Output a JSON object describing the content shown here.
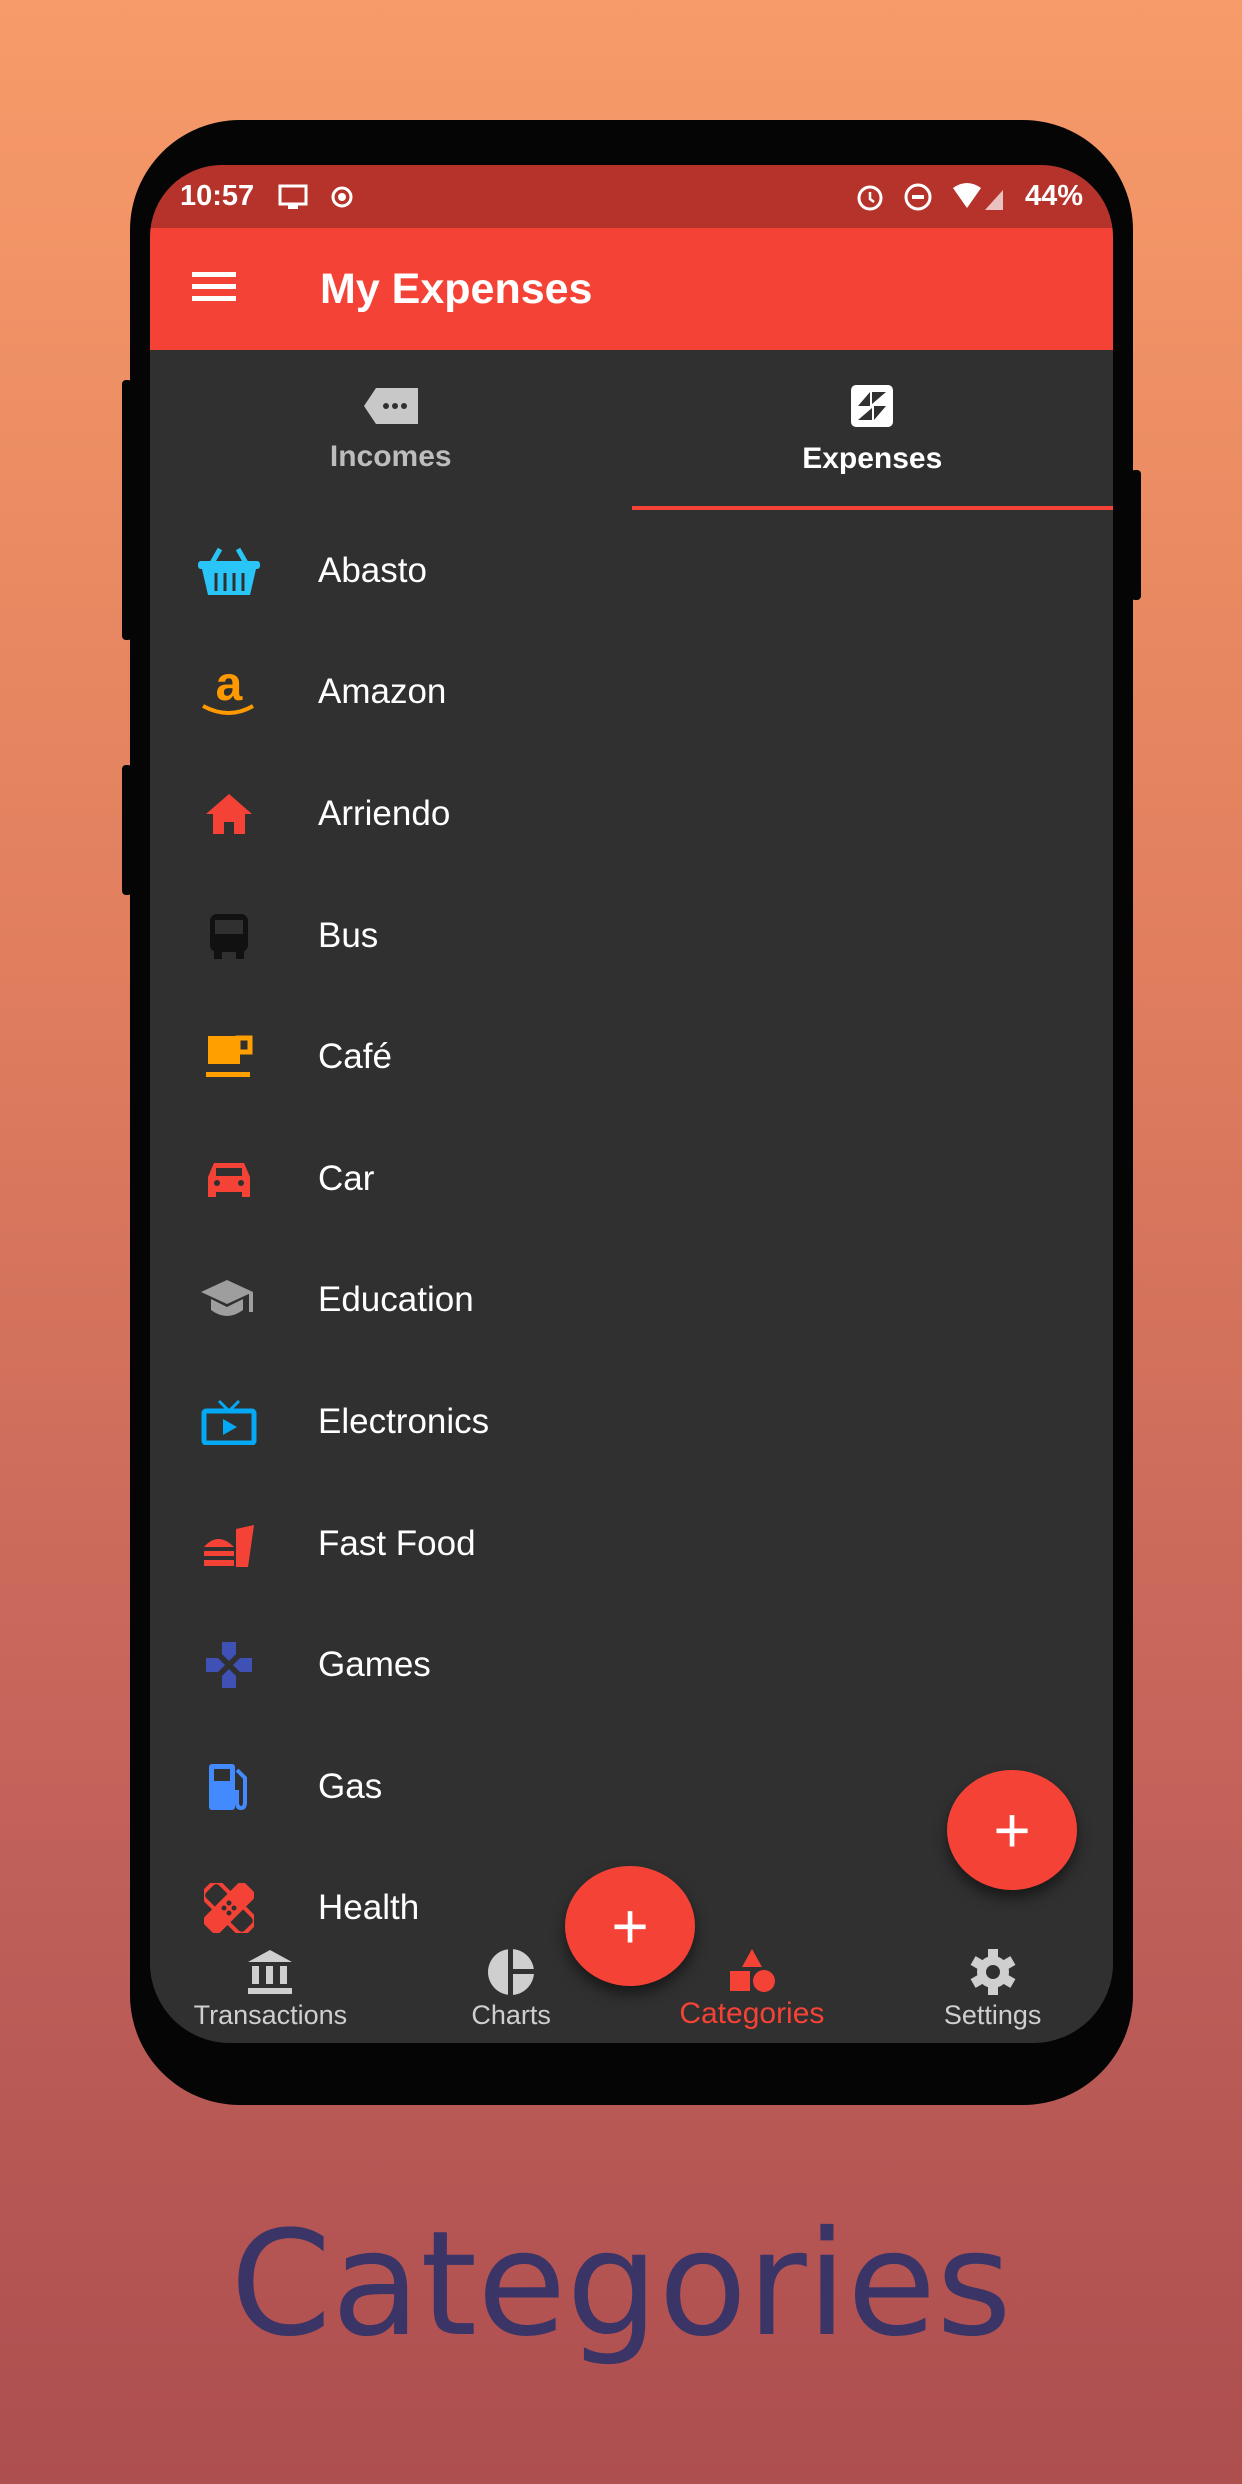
{
  "status_bar": {
    "time": "10:57",
    "battery": "44%"
  },
  "app_bar": {
    "title": "My Expenses",
    "menu_icon": "hamburger-icon"
  },
  "tabs": [
    {
      "label": "Incomes",
      "icon": "label-tag-icon",
      "active": false
    },
    {
      "label": "Expenses",
      "icon": "expand-arrows-icon",
      "active": true
    }
  ],
  "categories": [
    {
      "label": "Abasto",
      "icon": "basket-icon",
      "color": "#29c5f6"
    },
    {
      "label": "Amazon",
      "icon": "amazon-icon",
      "color": "#ff9900"
    },
    {
      "label": "Arriendo",
      "icon": "home-icon",
      "color": "#f44336"
    },
    {
      "label": "Bus",
      "icon": "bus-icon",
      "color": "#111111"
    },
    {
      "label": "Café",
      "icon": "coffee-icon",
      "color": "#ffa000"
    },
    {
      "label": "Car",
      "icon": "car-icon",
      "color": "#f44336"
    },
    {
      "label": "Education",
      "icon": "graduation-cap-icon",
      "color": "#9e9e9e"
    },
    {
      "label": "Electronics",
      "icon": "tv-icon",
      "color": "#03a9f4"
    },
    {
      "label": "Fast Food",
      "icon": "fast-food-icon",
      "color": "#f44336"
    },
    {
      "label": "Games",
      "icon": "gamepad-icon",
      "color": "#3f51b5"
    },
    {
      "label": "Gas",
      "icon": "gas-station-icon",
      "color": "#448aff"
    },
    {
      "label": "Health",
      "icon": "bandage-icon",
      "color": "#f44336"
    }
  ],
  "bottom_nav": [
    {
      "label": "Transactions",
      "icon": "bank-icon"
    },
    {
      "label": "Charts",
      "icon": "pie-chart-icon"
    },
    {
      "label": "Categories",
      "icon": "shapes-icon",
      "active": true
    },
    {
      "label": "Settings",
      "icon": "gear-icon"
    }
  ],
  "fab": {
    "symbol": "+"
  },
  "caption": "Categories",
  "colors": {
    "primary": "#f44336",
    "status": "#b5332b",
    "background": "#303030"
  }
}
